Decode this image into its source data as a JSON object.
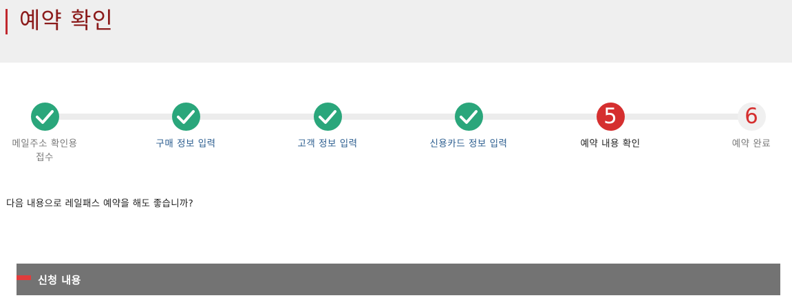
{
  "header": {
    "title": "예약 확인"
  },
  "steps": [
    {
      "label": "메일주소 확인용 접수",
      "status": "done",
      "icon": "check-icon"
    },
    {
      "label": "구매 정보 입력",
      "status": "done",
      "icon": "check-icon"
    },
    {
      "label": "고객 정보 입력",
      "status": "done",
      "icon": "check-icon"
    },
    {
      "label": "신용카드 정보 입력",
      "status": "done",
      "icon": "check-icon"
    },
    {
      "label": "예약 내용 확인",
      "status": "active",
      "number": "5"
    },
    {
      "label": "예약 완료",
      "status": "pending",
      "number": "6"
    }
  ],
  "main": {
    "question": "다음 내용으로 레일패스 예약을 해도 좋습니까?"
  },
  "section": {
    "title": "신청 내용"
  },
  "colors": {
    "done": "#2aa67b",
    "active": "#d52f2f",
    "title": "#8b1a1a",
    "section_bg": "#737373"
  }
}
